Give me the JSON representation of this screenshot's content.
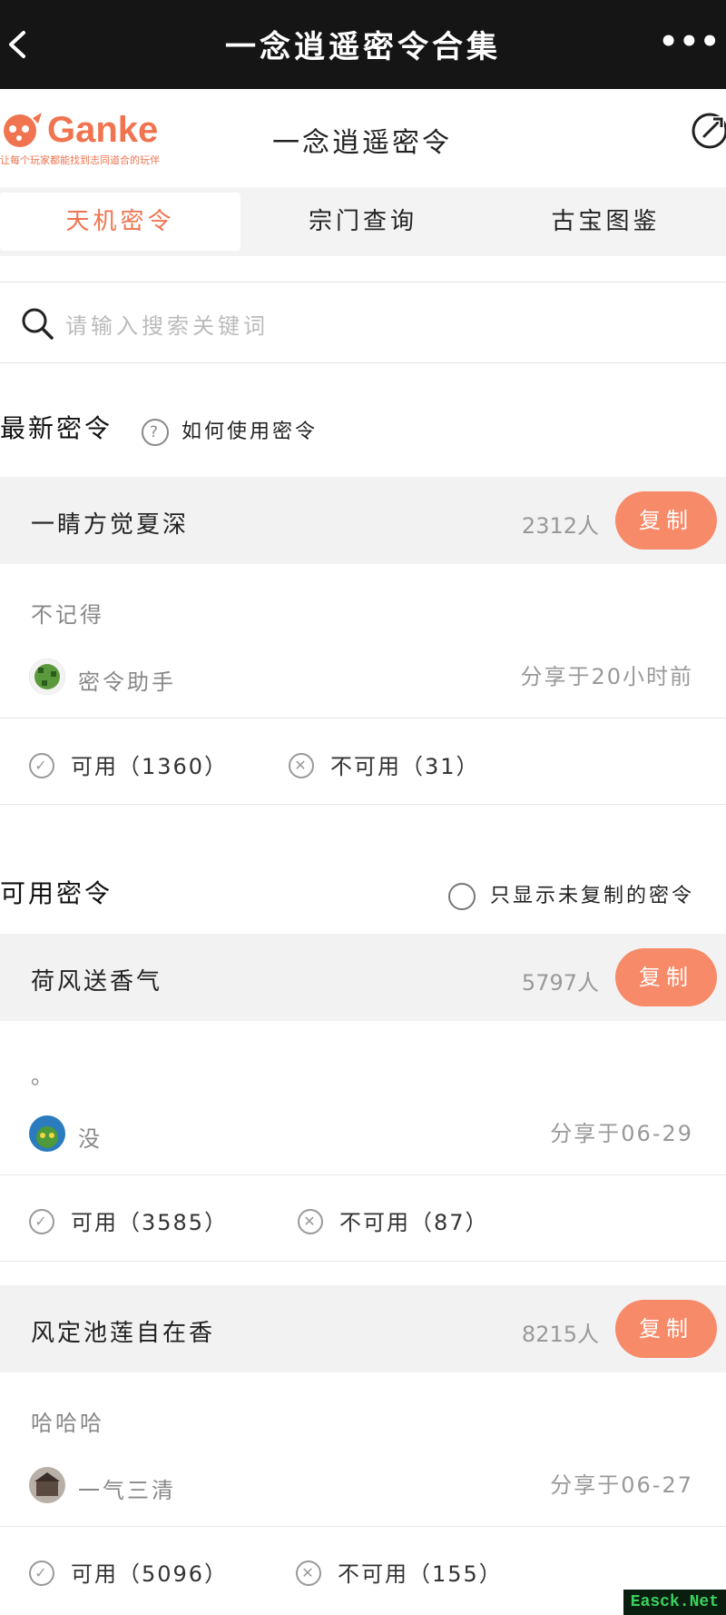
{
  "topbar": {
    "title": "一念逍遥密令合集",
    "more": "•••"
  },
  "header": {
    "brand": "Ganke",
    "slogan": "让每个玩家都能找到志同道合的玩伴",
    "page_title": "一念逍遥密令"
  },
  "tabs": [
    {
      "label": "天机密令",
      "active": true
    },
    {
      "label": "宗门查询"
    },
    {
      "label": "古宝图鉴"
    }
  ],
  "search": {
    "placeholder": "请输入搜索关键词"
  },
  "latest": {
    "title": "最新密令",
    "help": "如何使用密令"
  },
  "available": {
    "title": "可用密令",
    "filter": "只显示未复制的密令"
  },
  "cards": [
    {
      "name": "一睛方觉夏深",
      "count": "2312人",
      "copy": "复制",
      "note": "不记得",
      "user": "密令助手",
      "time": "分享于20小时前",
      "ok": "可用（1360）",
      "bad": "不可用（31）"
    },
    {
      "name": "荷风送香气",
      "count": "5797人",
      "copy": "复制",
      "note": "。",
      "user": "没",
      "time": "分享于06-29",
      "ok": "可用（3585）",
      "bad": "不可用（87）"
    },
    {
      "name": "风定池莲自在香",
      "count": "8215人",
      "copy": "复制",
      "note": "哈哈哈",
      "user": "一气三清",
      "time": "分享于06-27",
      "ok": "可用（5096）",
      "bad": "不可用（155）"
    }
  ],
  "watermark": "Easck.Net",
  "colors": {
    "accent": "#f0744f",
    "copy_button": "#f78a68",
    "topbar": "#151515"
  },
  "icons": [
    "back-arrow-icon",
    "more-icon",
    "share-icon",
    "search-icon",
    "help-icon",
    "check-circle-icon",
    "cross-circle-icon",
    "radio-icon"
  ]
}
